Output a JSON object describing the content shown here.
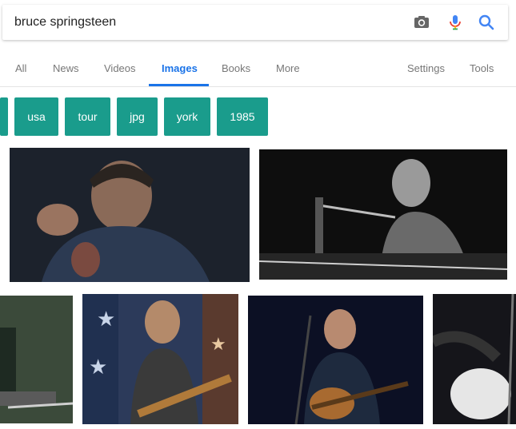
{
  "search": {
    "query": "bruce springsteen"
  },
  "tabs": [
    {
      "label": "All"
    },
    {
      "label": "News"
    },
    {
      "label": "Videos"
    },
    {
      "label": "Images",
      "active": true
    },
    {
      "label": "Books"
    },
    {
      "label": "More"
    }
  ],
  "tools": {
    "settings": "Settings",
    "tools": "Tools"
  },
  "chips": [
    "usa",
    "tour",
    "jpg",
    "york",
    "1985"
  ],
  "colors": {
    "accent": "#1a73e8",
    "chip": "#1a9c8c"
  }
}
